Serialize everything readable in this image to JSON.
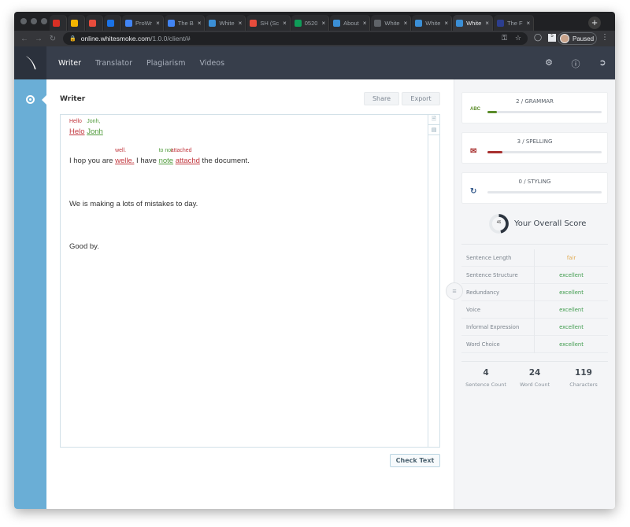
{
  "browser": {
    "tabs": [
      {
        "label": "",
        "favicon": "gmail-icon",
        "color": "#d93025"
      },
      {
        "label": "",
        "favicon": "google-drive-icon",
        "color": "#f4b400"
      },
      {
        "label": "",
        "favicon": "app-icon",
        "color": "#e74c3c"
      },
      {
        "label": "",
        "favicon": "calendar-icon",
        "color": "#1a73e8"
      },
      {
        "label": "ProWr",
        "favicon": "docs-icon",
        "color": "#4285f4"
      },
      {
        "label": "The B",
        "favicon": "docs-icon",
        "color": "#4285f4"
      },
      {
        "label": "White",
        "favicon": "whitesmoke-icon",
        "color": "#3b8fd6"
      },
      {
        "label": "SH (Sc",
        "favicon": "app-icon",
        "color": "#e74c3c"
      },
      {
        "label": "0520",
        "favicon": "sheets-icon",
        "color": "#0f9d58"
      },
      {
        "label": "About",
        "favicon": "whitesmoke-icon",
        "color": "#3b8fd6"
      },
      {
        "label": "White",
        "favicon": "loading-icon",
        "color": "#5f6368"
      },
      {
        "label": "White",
        "favicon": "whitesmoke-icon",
        "color": "#3b8fd6"
      },
      {
        "label": "White",
        "favicon": "whitesmoke-icon",
        "color": "#3b8fd6",
        "active": true
      },
      {
        "label": "The F",
        "favicon": "k-icon",
        "color": "#2c3e8f"
      }
    ],
    "url_host": "online.whitesmoke.com",
    "url_path": "/1.0.0/client/#",
    "profile_status": "Paused"
  },
  "header": {
    "nav": [
      {
        "label": "Writer",
        "active": true
      },
      {
        "label": "Translator",
        "active": false
      },
      {
        "label": "Plagiarism",
        "active": false
      },
      {
        "label": "Videos",
        "active": false
      }
    ]
  },
  "main": {
    "title": "Writer",
    "share_label": "Share",
    "export_label": "Export",
    "check_label": "Check Text",
    "editor": {
      "line1": {
        "err1": {
          "text": "Helo",
          "suggestion": "Hello"
        },
        "err2": {
          "text": "Jonh",
          "suggestion": "Jonh,"
        }
      },
      "line2": {
        "pre": "I hop you are ",
        "err1": {
          "text": "welle.",
          "suggestion": "well."
        },
        "mid": " I have ",
        "err2": {
          "text": "note",
          "suggestion": "to not"
        },
        "space": " ",
        "err3": {
          "text": "attachd",
          "suggestion": "attached"
        },
        "post": " the document."
      },
      "line3": "We is making a lots of mistakes to day.",
      "line4": "Good by."
    }
  },
  "panel": {
    "cards": [
      {
        "title": "2 / GRAMMAR",
        "icon": "abc-check-icon",
        "progress": 0.08,
        "color": "#5b8c2a"
      },
      {
        "title": "3 / SPELLING",
        "icon": "spelling-board-icon",
        "progress": 0.13,
        "color": "#a8302f"
      },
      {
        "title": "0 / STYLING",
        "icon": "styling-icon",
        "progress": 0.0,
        "color": "#3b5f8f"
      }
    ],
    "overall": {
      "label": "Your Overall Score",
      "value": "46",
      "fraction": 0.46
    },
    "metrics": [
      {
        "label": "Sentence Length",
        "value": "fair",
        "color": "#e0a94f"
      },
      {
        "label": "Sentence Structure",
        "value": "excellent",
        "color": "#3c9a4a"
      },
      {
        "label": "Redundancy",
        "value": "excellent",
        "color": "#3c9a4a"
      },
      {
        "label": "Voice",
        "value": "excellent",
        "color": "#3c9a4a"
      },
      {
        "label": "Informal Expression",
        "value": "excellent",
        "color": "#3c9a4a"
      },
      {
        "label": "Word Choice",
        "value": "excellent",
        "color": "#3c9a4a"
      }
    ],
    "stats": [
      {
        "value": "4",
        "label": "Sentence Count"
      },
      {
        "value": "24",
        "label": "Word Count"
      },
      {
        "value": "119",
        "label": "Characters"
      }
    ]
  }
}
